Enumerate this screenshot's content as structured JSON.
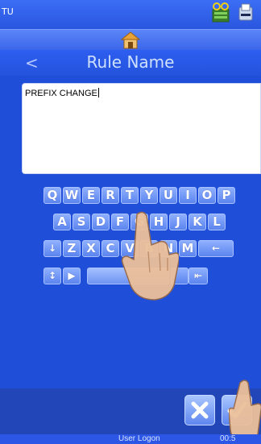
{
  "app": {
    "name": "TU"
  },
  "header": {
    "title": "Rule Name",
    "back_glyph": "<"
  },
  "icons": {
    "top": [
      "tape-icon",
      "label-printer-icon"
    ],
    "home": "home-icon"
  },
  "text_field": {
    "value": "PREFIX CHANGE"
  },
  "keyboard": {
    "row1": [
      "Q",
      "W",
      "E",
      "R",
      "T",
      "Y",
      "U",
      "I",
      "O",
      "P"
    ],
    "row2": [
      "A",
      "S",
      "D",
      "F",
      "G",
      "H",
      "J",
      "K",
      "L"
    ],
    "row3_glyphs": [
      "↓",
      "Z",
      "X",
      "C",
      "V",
      "B",
      "N",
      "M",
      "←"
    ],
    "row4_glyphs": [
      "↕",
      "▶",
      "",
      "",
      "⇤"
    ]
  },
  "buttons": {
    "cancel": "cancel-icon",
    "confirm": "checkmark-icon"
  },
  "status": {
    "user": "User Logon",
    "time": "00:5"
  },
  "colors": {
    "background": "#1f4fd8",
    "key": "#6f95f2",
    "title": "#cfe0ff"
  }
}
